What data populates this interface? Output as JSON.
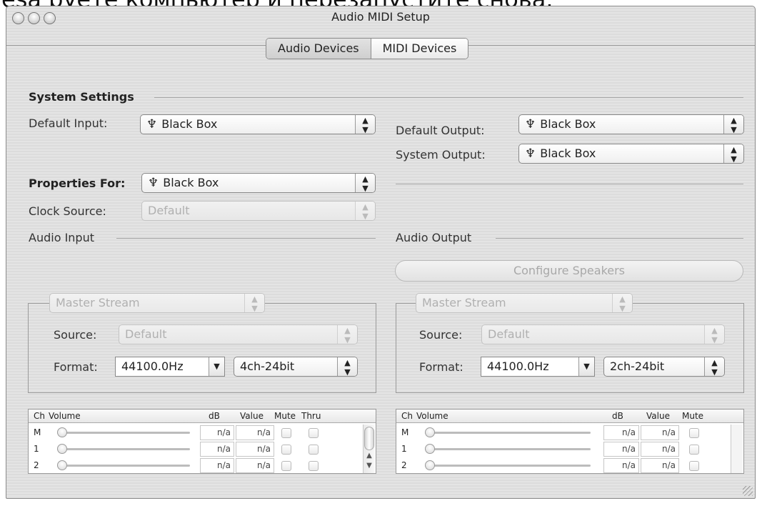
{
  "caption": "ésa руете компьютер и перезапустите снова.",
  "window": {
    "title": "Audio MIDI Setup"
  },
  "tabs": [
    {
      "label": "Audio Devices",
      "selected": true
    },
    {
      "label": "MIDI Devices",
      "selected": false
    }
  ],
  "system_settings": {
    "heading": "System Settings",
    "default_input_label": "Default Input:",
    "default_input_value": "Black Box",
    "default_output_label": "Default Output:",
    "default_output_value": "Black Box",
    "system_output_label": "System Output:",
    "system_output_value": "Black Box"
  },
  "properties": {
    "label": "Properties For:",
    "value": "Black Box",
    "clock_label": "Clock Source:",
    "clock_value": "Default"
  },
  "audio_input": {
    "heading": "Audio Input",
    "stream": "Master Stream",
    "source_label": "Source:",
    "source_value": "Default",
    "format_label": "Format:",
    "rate": "44100.0Hz",
    "bits": "4ch-24bit",
    "table": {
      "headers": [
        "Ch",
        "Volume",
        "dB",
        "Value",
        "Mute",
        "Thru"
      ],
      "rows": [
        {
          "ch": "M",
          "db": "n/a",
          "value": "n/a"
        },
        {
          "ch": "1",
          "db": "n/a",
          "value": "n/a"
        },
        {
          "ch": "2",
          "db": "n/a",
          "value": "n/a"
        }
      ]
    }
  },
  "audio_output": {
    "heading": "Audio Output",
    "configure_speakers": "Configure Speakers",
    "stream": "Master Stream",
    "source_label": "Source:",
    "source_value": "Default",
    "format_label": "Format:",
    "rate": "44100.0Hz",
    "bits": "2ch-24bit",
    "table": {
      "headers": [
        "Ch",
        "Volume",
        "dB",
        "Value",
        "Mute"
      ],
      "rows": [
        {
          "ch": "M",
          "db": "n/a",
          "value": "n/a"
        },
        {
          "ch": "1",
          "db": "n/a",
          "value": "n/a"
        },
        {
          "ch": "2",
          "db": "n/a",
          "value": "n/a"
        }
      ]
    }
  },
  "icons": {
    "usb": "usb-icon",
    "popup": "updown-arrows-icon",
    "combo": "down-arrow-icon"
  }
}
